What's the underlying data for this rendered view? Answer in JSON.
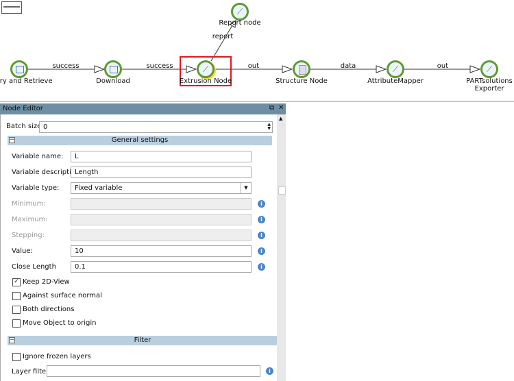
{
  "canvas": {
    "nodes": [
      {
        "label": "Query and Retrieve",
        "icon": "query-icon"
      },
      {
        "label": "Download",
        "icon": "query-icon"
      },
      {
        "label": "Extrusion Node",
        "icon": "script-icon",
        "selected": true
      },
      {
        "label": "Report node",
        "icon": "script-icon"
      },
      {
        "label": "Structure Node",
        "icon": "document-icon"
      },
      {
        "label": "AttributeMapper",
        "icon": "script-icon"
      },
      {
        "label": "PARTsolutions Exporter",
        "icon": "script-icon"
      }
    ],
    "edges": [
      "success",
      "success",
      "report",
      "out",
      "data",
      "out"
    ],
    "selection_color": "#e8141c"
  },
  "editor": {
    "title": "Node Editor",
    "batch_label": "Batch size:",
    "batch_value": "0",
    "general": "General settings",
    "fields": [
      {
        "label": "Variable name:",
        "value": "L"
      },
      {
        "label": "Variable description:",
        "value": "Length"
      },
      {
        "label": "Variable type:",
        "value": "Fixed variable"
      },
      {
        "label": "Minimum:",
        "value": ""
      },
      {
        "label": "Maximum:",
        "value": ""
      },
      {
        "label": "Stepping:",
        "value": ""
      },
      {
        "label": "Value:",
        "value": "10"
      },
      {
        "label": "Close Length",
        "value": "0.1"
      }
    ],
    "checks": [
      {
        "label": "Keep 2D-View",
        "checked": true
      },
      {
        "label": "Against surface normal",
        "checked": false
      },
      {
        "label": "Both directions",
        "checked": false
      },
      {
        "label": "Move Object to origin",
        "checked": false
      }
    ],
    "filter": "Filter",
    "ignore_frozen": "Ignore frozen layers",
    "layer_filter_label": "Layer filter:",
    "layer_filter_value": ""
  }
}
